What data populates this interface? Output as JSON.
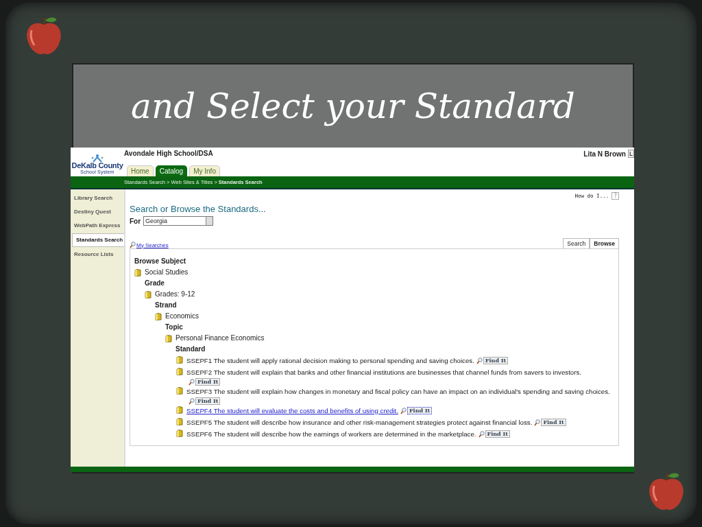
{
  "slide": {
    "title": "and Select your Standard"
  },
  "app": {
    "school": "Avondale High School/DSA",
    "user": "Lita N Brown",
    "user_button": "L",
    "logo": {
      "name": "DeKalb County",
      "subtitle": "School System"
    },
    "tabs": [
      {
        "label": "Home",
        "selected": false
      },
      {
        "label": "Catalog",
        "selected": true
      },
      {
        "label": "My Info",
        "selected": false
      }
    ],
    "breadcrumb": "Standards Search > Web Sites & Titles > **Standards Search**",
    "sidebar": [
      {
        "label": "Library Search",
        "selected": false
      },
      {
        "label": "Destiny Quest",
        "selected": false
      },
      {
        "label": "WebPath Express",
        "selected": false
      },
      {
        "label": "Standards Search",
        "selected": true
      },
      {
        "label": "Resource Lists",
        "selected": false
      }
    ],
    "help": {
      "label": "How do I...",
      "button": "?"
    },
    "heading": "Search or Browse the Standards...",
    "for_label": "For",
    "state_select": "Georgia",
    "my_searches": "My Searches",
    "view_tabs": [
      {
        "label": "Search",
        "selected": false
      },
      {
        "label": "Browse",
        "selected": true
      }
    ],
    "browse": {
      "label": "Browse Subject",
      "item": "Social Studies",
      "children": [
        {
          "label": "Grade",
          "item": "Grades: 9-12",
          "children": [
            {
              "label": "Strand",
              "item": "Economics",
              "children": [
                {
                  "label": "Topic",
                  "item": "Personal Finance Economics",
                  "children": [
                    {
                      "label": "Standard",
                      "standards": [
                        {
                          "text": "SSEPF1 The student will apply rational decision making to personal spending and saving choices.",
                          "button": "Find It",
                          "highlighted": false
                        },
                        {
                          "text": "SSEPF2 The student will explain that banks and other financial institutions are businesses that channel funds from savers to investors.",
                          "button": "Find It",
                          "highlighted": false
                        },
                        {
                          "text": "SSEPF3 The student will explain how changes in monetary and fiscal policy can have an impact on an individual's spending and saving choices.",
                          "button": "Find It",
                          "highlighted": false
                        },
                        {
                          "text": "SSEPF4 The student will evaluate the costs and benefits of using credit.",
                          "button": "Find It",
                          "highlighted": true
                        },
                        {
                          "text": "SSEPF5 The student will describe how insurance and other risk-management strategies protect against financial loss.",
                          "button": "Find It",
                          "highlighted": false
                        },
                        {
                          "text": "SSEPF6 The student will describe how the earnings of workers are determined in the marketplace.",
                          "button": "Find It",
                          "highlighted": false
                        }
                      ]
                    }
                  ]
                }
              ]
            }
          ]
        }
      ]
    }
  }
}
